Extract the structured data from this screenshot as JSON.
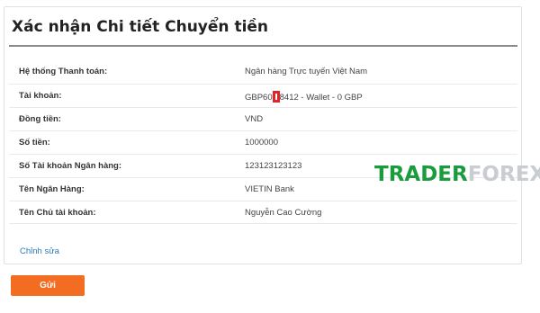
{
  "page": {
    "title": "Xác nhận Chi tiết Chuyển tiền"
  },
  "details": [
    {
      "label": "Hệ thống Thanh toán:",
      "value": "Ngân hàng Trực tuyến Việt Nam"
    },
    {
      "label": "Tài khoản:",
      "value_prefix": "GBP60",
      "value_suffix": "8412 - Wallet - 0 GBP"
    },
    {
      "label": "Đồng tiền:",
      "value": "VND"
    },
    {
      "label": "Số tiền:",
      "value": "1000000"
    },
    {
      "label": "Số Tài khoản Ngân hàng:",
      "value": "123123123123"
    },
    {
      "label": "Tên Ngân Hàng:",
      "value": "VIETIN Bank"
    },
    {
      "label": "Tên Chủ tài khoản:",
      "value": "Nguyễn Cao Cường"
    }
  ],
  "edit_link": "Chỉnh sửa",
  "send_button": "Gửi",
  "watermark": {
    "part1": "TRADER",
    "part2": "FOREX"
  },
  "colors": {
    "accent_button": "#f26d21",
    "link": "#2a7ab8",
    "mask": "#e0242b",
    "watermark_green": "#1a9c3e"
  }
}
